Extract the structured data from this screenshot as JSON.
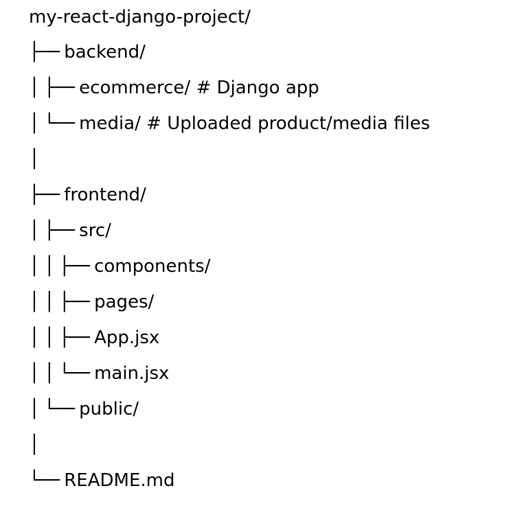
{
  "tree": {
    "lines": [
      {
        "prefix": "",
        "name": "my-react-django-project/"
      },
      {
        "prefix": "├── ",
        "name": "backend/"
      },
      {
        "prefix": "│ ├── ",
        "name": "ecommerce/ # Django app"
      },
      {
        "prefix": "│ └── ",
        "name": "media/ # Uploaded product/media files"
      },
      {
        "prefix": "│",
        "name": ""
      },
      {
        "prefix": "├── ",
        "name": "frontend/"
      },
      {
        "prefix": "│ ├── ",
        "name": "src/"
      },
      {
        "prefix": "│ │ ├── ",
        "name": "components/"
      },
      {
        "prefix": "│ │ ├── ",
        "name": "pages/"
      },
      {
        "prefix": "│ │ ├── ",
        "name": "App.jsx"
      },
      {
        "prefix": "│ │ └── ",
        "name": "main.jsx"
      },
      {
        "prefix": "│ └── ",
        "name": "public/"
      },
      {
        "prefix": "│",
        "name": ""
      },
      {
        "prefix": "└── ",
        "name": "README.md"
      }
    ]
  }
}
